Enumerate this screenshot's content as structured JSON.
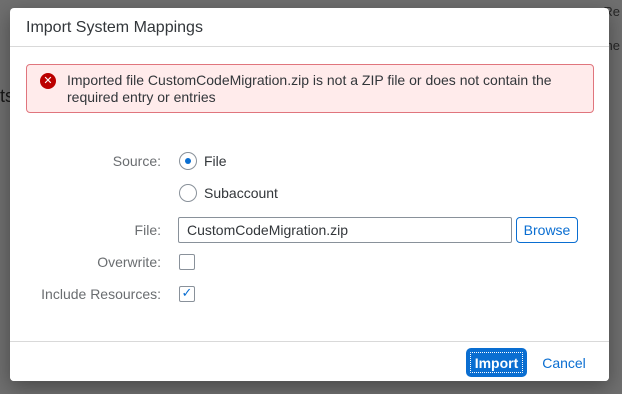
{
  "background": {
    "right_text_top": "Re",
    "right_text_second": "he",
    "left_text": "ts"
  },
  "dialog": {
    "title": "Import System Mappings",
    "error": {
      "icon": "error-circle-icon",
      "message": "Imported file CustomCodeMigration.zip is not a ZIP file or does not contain the required entry or entries"
    },
    "form": {
      "source_label": "Source:",
      "source_options": [
        {
          "label": "File",
          "selected": true
        },
        {
          "label": "Subaccount",
          "selected": false
        }
      ],
      "file_label": "File:",
      "file_value": "CustomCodeMigration.zip",
      "browse_label": "Browse",
      "overwrite_label": "Overwrite:",
      "overwrite_checked": false,
      "include_resources_label": "Include Resources:",
      "include_resources_checked": true
    },
    "footer": {
      "import_label": "Import",
      "cancel_label": "Cancel"
    }
  },
  "colors": {
    "accent": "#0a6ed1",
    "error": "#bb0000",
    "error_bg": "#ffebeb"
  }
}
